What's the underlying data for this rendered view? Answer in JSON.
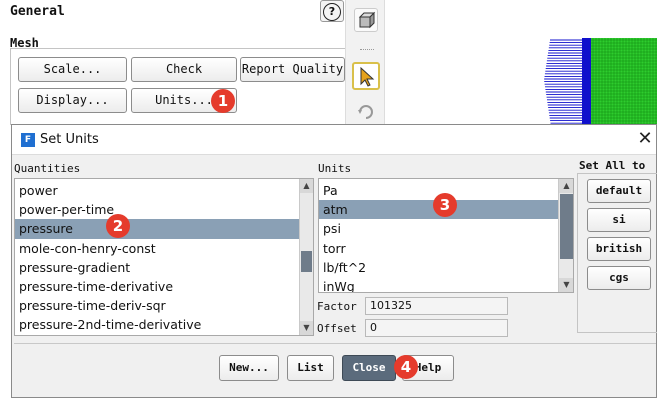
{
  "general": {
    "title": "General",
    "help_icon": "question-circle-icon",
    "mesh_label": "Mesh",
    "buttons": {
      "scale": "Scale...",
      "check": "Check",
      "report_quality": "Report Quality",
      "display": "Display...",
      "units": "Units..."
    }
  },
  "dialog": {
    "title": "Set Units",
    "app_icon": "F",
    "quantities": {
      "label": "Quantities",
      "items": [
        "power",
        "power-per-time",
        "pressure",
        "mole-con-henry-const",
        "pressure-gradient",
        "pressure-time-derivative",
        "pressure-time-deriv-sqr",
        "pressure-2nd-time-derivative"
      ],
      "selected": "pressure"
    },
    "units": {
      "label": "Units",
      "items": [
        "Pa",
        "atm",
        "psi",
        "torr",
        "lb/ft^2",
        "inWg"
      ],
      "selected": "atm"
    },
    "factor": {
      "label": "Factor",
      "value": "101325"
    },
    "offset": {
      "label": "Offset",
      "value": "0"
    },
    "set_all_to": {
      "label": "Set All to",
      "buttons": [
        "default",
        "si",
        "british",
        "cgs"
      ]
    },
    "footer": {
      "new": "New...",
      "list": "List",
      "close": "Close",
      "help": "Help"
    }
  },
  "badges": [
    "1",
    "2",
    "3",
    "4"
  ],
  "colors": {
    "selection": "#8aa0b5",
    "badge": "#e53b2c",
    "mesh_green": "#2ecc2e",
    "vector_blue": "#1010cc"
  }
}
